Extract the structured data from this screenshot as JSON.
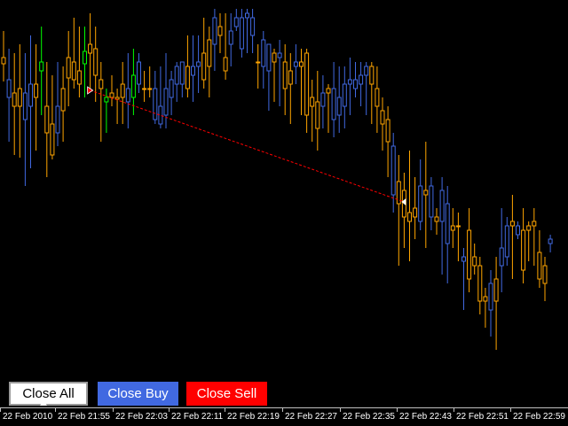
{
  "buttons": {
    "close_all": "Close All",
    "close_buy": "Close Buy",
    "close_sell": "Close Sell"
  },
  "colors": {
    "background": "#000000",
    "bull_candle": "#4169e1",
    "bear_candle": "#ffa500",
    "buy_marker": "#00ff00",
    "order_line": "#ff0000",
    "axis": "#c0c0c0",
    "text": "#ffffff"
  },
  "time_axis": {
    "labels": [
      "22 Feb 2010",
      "22 Feb 21:55",
      "22 Feb 22:03",
      "22 Feb 22:11",
      "22 Feb 22:19",
      "22 Feb 22:27",
      "22 Feb 22:35",
      "22 Feb 22:43",
      "22 Feb 22:51",
      "22 Feb 22:59"
    ]
  },
  "chart_data": {
    "type": "candlestick",
    "grid": false,
    "candles": [
      {
        "o": 65,
        "c": 72,
        "h": 35,
        "l": 92
      },
      {
        "o": 110,
        "c": 90,
        "h": 55,
        "l": 160
      },
      {
        "o": 105,
        "c": 120,
        "h": 60,
        "l": 175
      },
      {
        "o": 100,
        "c": 120,
        "h": 50,
        "l": 178
      },
      {
        "o": 135,
        "c": 105,
        "h": 60,
        "l": 210
      },
      {
        "o": 120,
        "c": 95,
        "h": 40,
        "l": 190
      },
      {
        "o": 95,
        "c": 110,
        "h": 50,
        "l": 170
      },
      {
        "o": 70,
        "c": 80,
        "h": 30,
        "l": 130
      },
      {
        "o": 120,
        "c": 150,
        "h": 70,
        "l": 200
      },
      {
        "o": 140,
        "c": 175,
        "h": 85,
        "l": 180
      },
      {
        "o": 150,
        "c": 120,
        "h": 70,
        "l": 165
      },
      {
        "o": 100,
        "c": 125,
        "h": 75,
        "l": 160
      },
      {
        "o": 65,
        "c": 88,
        "h": 35,
        "l": 120
      },
      {
        "o": 70,
        "c": 90,
        "h": 20,
        "l": 100
      },
      {
        "o": 80,
        "c": 95,
        "h": 30,
        "l": 110
      },
      {
        "o": 58,
        "c": 72,
        "h": 30,
        "l": 110
      },
      {
        "o": 50,
        "c": 60,
        "h": 15,
        "l": 100
      },
      {
        "o": 55,
        "c": 85,
        "h": 30,
        "l": 115
      },
      {
        "o": 90,
        "c": 100,
        "h": 70,
        "l": 160
      },
      {
        "o": 115,
        "c": 110,
        "h": 100,
        "l": 150
      },
      {
        "o": 105,
        "c": 110,
        "h": 85,
        "l": 120
      },
      {
        "o": 110,
        "c": 112,
        "h": 100,
        "l": 140
      },
      {
        "o": 95,
        "c": 110,
        "h": 70,
        "l": 140
      },
      {
        "o": 115,
        "c": 100,
        "h": 60,
        "l": 145
      },
      {
        "o": 110,
        "c": 85,
        "h": 55,
        "l": 130
      },
      {
        "o": 95,
        "c": 70,
        "h": 60,
        "l": 105
      },
      {
        "o": 100,
        "c": 100,
        "h": 80,
        "l": 115
      },
      {
        "o": 100,
        "c": 100,
        "h": 75,
        "l": 110
      },
      {
        "o": 135,
        "c": 100,
        "h": 80,
        "l": 140
      },
      {
        "o": 140,
        "c": 120,
        "h": 75,
        "l": 145
      },
      {
        "o": 130,
        "c": 100,
        "h": 60,
        "l": 145
      },
      {
        "o": 110,
        "c": 90,
        "h": 80,
        "l": 130
      },
      {
        "o": 95,
        "c": 75,
        "h": 70,
        "l": 115
      },
      {
        "o": 95,
        "c": 70,
        "h": 70,
        "l": 110
      },
      {
        "o": 75,
        "c": 100,
        "h": 40,
        "l": 110
      },
      {
        "o": 85,
        "c": 75,
        "h": 40,
        "l": 115
      },
      {
        "o": 75,
        "c": 70,
        "h": 40,
        "l": 105
      },
      {
        "o": 60,
        "c": 90,
        "h": 20,
        "l": 100
      },
      {
        "o": 45,
        "c": 75,
        "h": 30,
        "l": 110
      },
      {
        "o": 50,
        "c": 20,
        "h": 10,
        "l": 80
      },
      {
        "o": 30,
        "c": 40,
        "h": 15,
        "l": 60
      },
      {
        "o": 65,
        "c": 80,
        "h": 15,
        "l": 90
      },
      {
        "o": 50,
        "c": 35,
        "h": 15,
        "l": 75
      },
      {
        "o": 30,
        "c": 20,
        "h": 10,
        "l": 35
      },
      {
        "o": 55,
        "c": 20,
        "h": 10,
        "l": 65
      },
      {
        "o": 20,
        "c": 15,
        "h": 10,
        "l": 60
      },
      {
        "o": 40,
        "c": 20,
        "h": 10,
        "l": 60
      },
      {
        "o": 70,
        "c": 70,
        "h": 50,
        "l": 100
      },
      {
        "o": 75,
        "c": 45,
        "h": 35,
        "l": 100
      },
      {
        "o": 80,
        "c": 50,
        "h": 50,
        "l": 125
      },
      {
        "o": 60,
        "c": 70,
        "h": 55,
        "l": 115
      },
      {
        "o": 65,
        "c": 60,
        "h": 45,
        "l": 120
      },
      {
        "o": 70,
        "c": 100,
        "h": 50,
        "l": 130
      },
      {
        "o": 80,
        "c": 95,
        "h": 60,
        "l": 140
      },
      {
        "o": 75,
        "c": 70,
        "h": 50,
        "l": 95
      },
      {
        "o": 70,
        "c": 75,
        "h": 55,
        "l": 130
      },
      {
        "o": 60,
        "c": 130,
        "h": 55,
        "l": 150
      },
      {
        "o": 110,
        "c": 120,
        "h": 90,
        "l": 160
      },
      {
        "o": 115,
        "c": 145,
        "h": 80,
        "l": 170
      },
      {
        "o": 120,
        "c": 105,
        "h": 85,
        "l": 145
      },
      {
        "o": 100,
        "c": 105,
        "h": 95,
        "l": 150
      },
      {
        "o": 135,
        "c": 100,
        "h": 70,
        "l": 155
      },
      {
        "o": 130,
        "c": 110,
        "h": 75,
        "l": 150
      },
      {
        "o": 120,
        "c": 95,
        "h": 75,
        "l": 145
      },
      {
        "o": 95,
        "c": 90,
        "h": 65,
        "l": 130
      },
      {
        "o": 100,
        "c": 90,
        "h": 70,
        "l": 110
      },
      {
        "o": 95,
        "c": 85,
        "h": 70,
        "l": 120
      },
      {
        "o": 85,
        "c": 75,
        "h": 70,
        "l": 130
      },
      {
        "o": 75,
        "c": 95,
        "h": 70,
        "l": 140
      },
      {
        "o": 100,
        "c": 120,
        "h": 75,
        "l": 150
      },
      {
        "o": 125,
        "c": 140,
        "h": 110,
        "l": 170
      },
      {
        "o": 135,
        "c": 160,
        "h": 120,
        "l": 200
      },
      {
        "o": 220,
        "c": 165,
        "h": 150,
        "l": 240
      },
      {
        "o": 205,
        "c": 230,
        "h": 175,
        "l": 300
      },
      {
        "o": 215,
        "c": 245,
        "h": 195,
        "l": 280
      },
      {
        "o": 240,
        "c": 250,
        "h": 170,
        "l": 295
      },
      {
        "o": 235,
        "c": 245,
        "h": 200,
        "l": 270
      },
      {
        "o": 250,
        "c": 210,
        "h": 180,
        "l": 260
      },
      {
        "o": 215,
        "c": 220,
        "h": 160,
        "l": 280
      },
      {
        "o": 245,
        "c": 210,
        "h": 200,
        "l": 260
      },
      {
        "o": 245,
        "c": 250,
        "h": 235,
        "l": 265
      },
      {
        "o": 250,
        "c": 215,
        "h": 200,
        "l": 310
      },
      {
        "o": 275,
        "c": 230,
        "h": 210,
        "l": 320
      },
      {
        "o": 255,
        "c": 260,
        "h": 235,
        "l": 280
      },
      {
        "o": 255,
        "c": 255,
        "h": 240,
        "l": 295
      },
      {
        "o": 295,
        "c": 290,
        "h": 280,
        "l": 350
      },
      {
        "o": 260,
        "c": 315,
        "h": 235,
        "l": 330
      },
      {
        "o": 290,
        "c": 300,
        "h": 275,
        "l": 310
      },
      {
        "o": 300,
        "c": 340,
        "h": 290,
        "l": 355
      },
      {
        "o": 335,
        "c": 340,
        "h": 325,
        "l": 370
      },
      {
        "o": 350,
        "c": 320,
        "h": 305,
        "l": 380
      },
      {
        "o": 315,
        "c": 340,
        "h": 290,
        "l": 395
      },
      {
        "o": 300,
        "c": 280,
        "h": 235,
        "l": 330
      },
      {
        "o": 290,
        "c": 255,
        "h": 245,
        "l": 300
      },
      {
        "o": 250,
        "c": 255,
        "h": 220,
        "l": 315
      },
      {
        "o": 265,
        "c": 255,
        "h": 250,
        "l": 270
      },
      {
        "o": 260,
        "c": 305,
        "h": 235,
        "l": 320
      },
      {
        "o": 255,
        "c": 260,
        "h": 250,
        "l": 295
      },
      {
        "o": 250,
        "c": 255,
        "h": 235,
        "l": 300
      },
      {
        "o": 285,
        "c": 315,
        "h": 260,
        "l": 325
      },
      {
        "o": 300,
        "c": 320,
        "h": 290,
        "l": 340
      },
      {
        "o": 275,
        "c": 270,
        "h": 265,
        "l": 285
      }
    ],
    "buy_marker_candles": [
      7,
      15,
      19,
      24
    ],
    "order_line": {
      "from_candle": 16,
      "from_price": 102,
      "to_candle": 74,
      "to_price": 228
    }
  }
}
